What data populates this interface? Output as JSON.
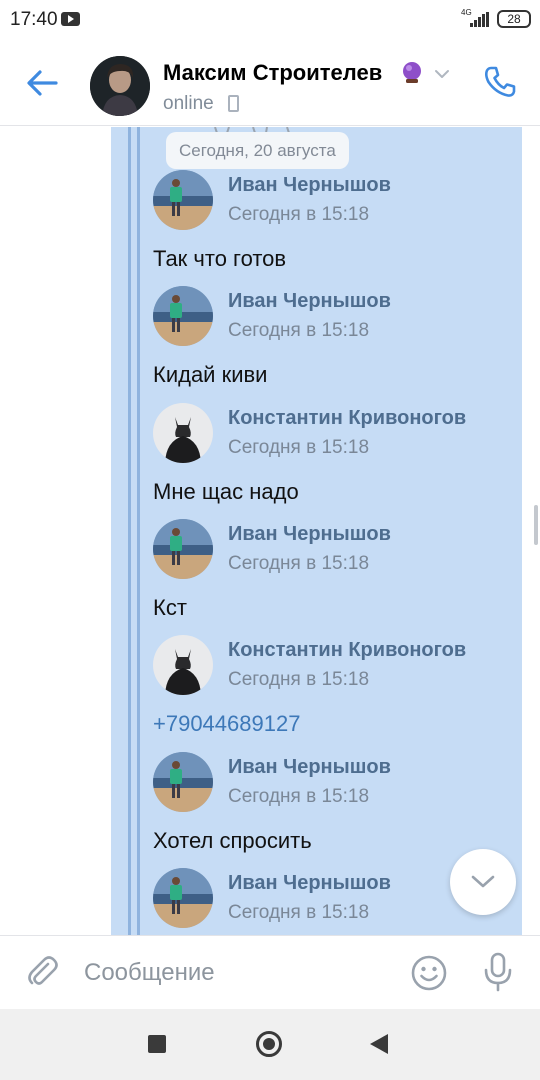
{
  "status_bar": {
    "time": "17:40",
    "network": "4G",
    "battery": "28"
  },
  "header": {
    "title": "Максим Строителев",
    "status": "online"
  },
  "chat": {
    "date_label": "Сегодня, 20 августа",
    "messages": [
      {
        "author": "Иван Чернышов",
        "time": "Сегодня в 15:18",
        "text": "Так что готов",
        "avatar": "ivan",
        "is_link": false
      },
      {
        "author": "Иван Чернышов",
        "time": "Сегодня в 15:18",
        "text": "Кидай киви",
        "avatar": "ivan",
        "is_link": false
      },
      {
        "author": "Константин Кривоногов",
        "time": "Сегодня в 15:18",
        "text": "Мне щас надо",
        "avatar": "konstantin",
        "is_link": false
      },
      {
        "author": "Иван Чернышов",
        "time": "Сегодня в 15:18",
        "text": "Кст",
        "avatar": "ivan",
        "is_link": false
      },
      {
        "author": "Константин Кривоногов",
        "time": "Сегодня в 15:18",
        "text": "+79044689127",
        "avatar": "konstantin",
        "is_link": true
      },
      {
        "author": "Иван Чернышов",
        "time": "Сегодня в 15:18",
        "text": "Хотел спросить",
        "avatar": "ivan",
        "is_link": false
      },
      {
        "author": "Иван Чернышов",
        "time": "Сегодня в 15:18",
        "text": "",
        "avatar": "ivan",
        "is_link": false
      }
    ]
  },
  "composer": {
    "placeholder": "Сообщение"
  },
  "colors": {
    "accent": "#3f8ae0",
    "forward_panel": "#c6dcf5",
    "author_name": "#4e6d8f",
    "link": "#3d78b8"
  },
  "icons": {
    "back": "arrow-left-icon",
    "phone": "phone-icon",
    "attach": "paperclip-icon",
    "emoji": "smile-icon",
    "mic": "microphone-icon",
    "scroll_down": "chevron-down-icon"
  }
}
